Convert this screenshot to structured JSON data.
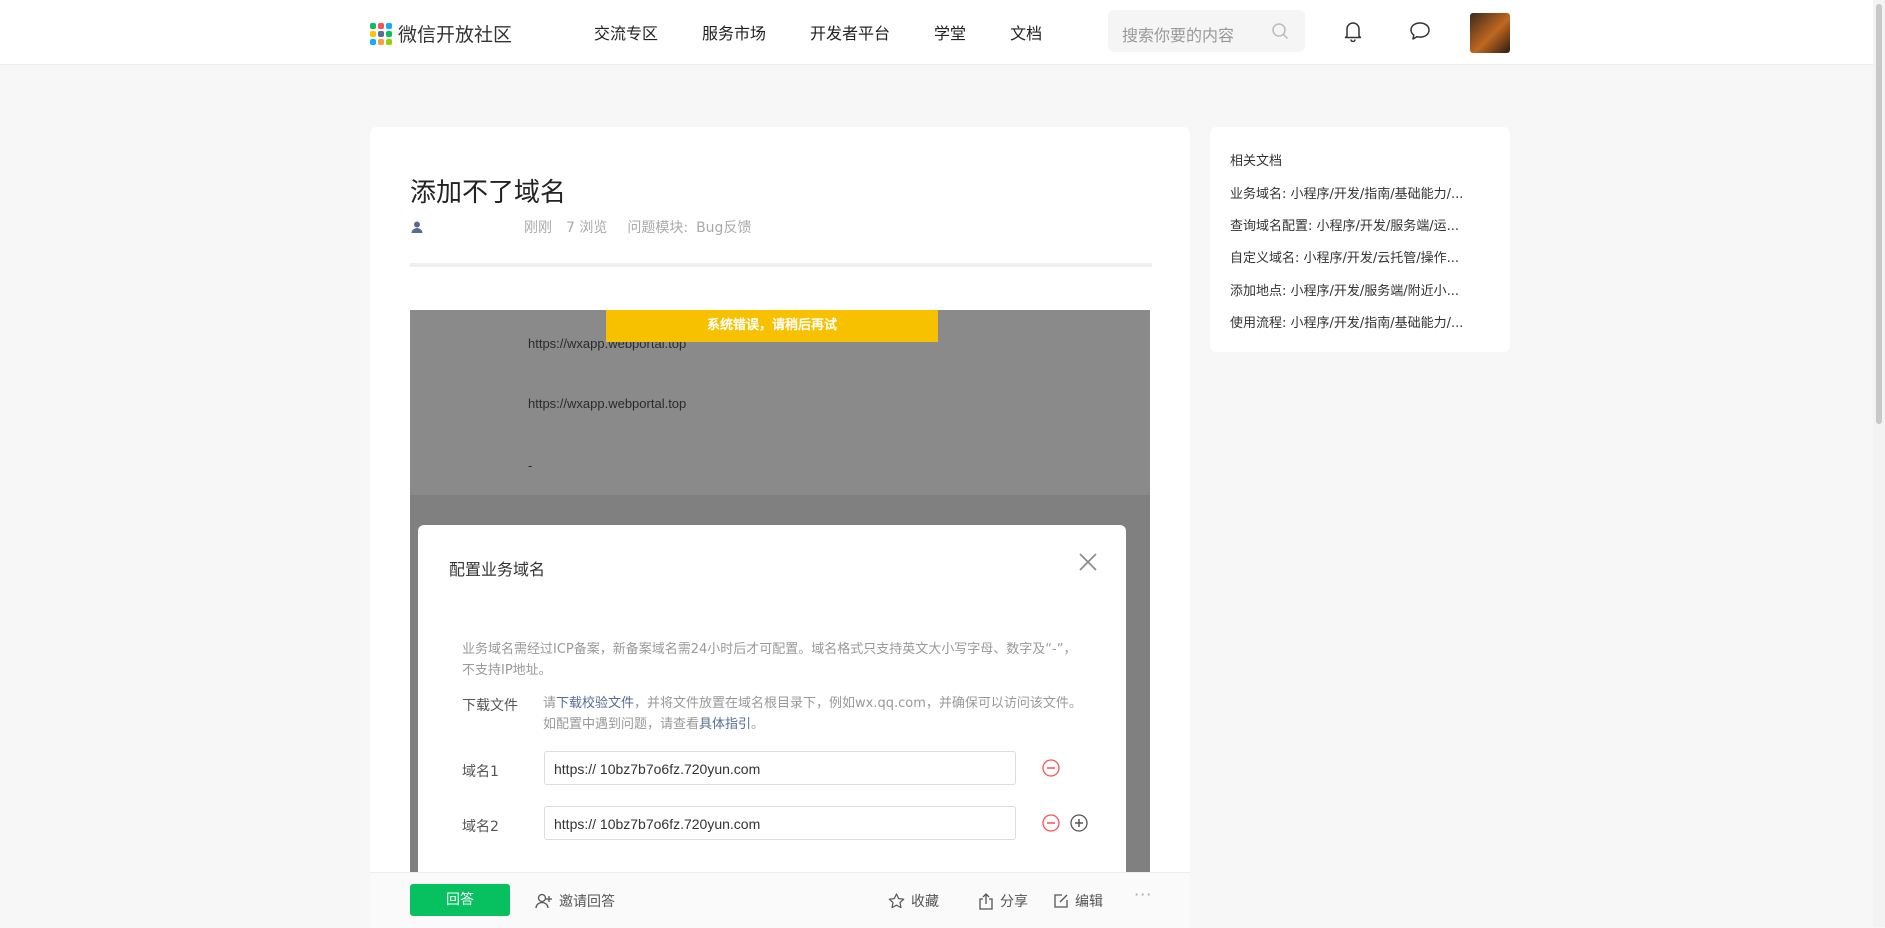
{
  "header": {
    "logo_text": "微信开放社区",
    "nav": [
      "交流专区",
      "服务市场",
      "开发者平台",
      "学堂",
      "文档"
    ],
    "search_placeholder": "搜索你要的内容"
  },
  "post": {
    "title": "添加不了域名",
    "time": "刚刚",
    "views": "7 浏览",
    "module_label": "问题模块:",
    "module_value": "Bug反馈"
  },
  "screenshot": {
    "error_toast": "系统错误，请稍后再试",
    "urls": [
      "https://wxapp.webportal.top",
      "https://wxapp.webportal.top",
      "-"
    ],
    "modal": {
      "title": "配置业务域名",
      "description": "业务域名需经过ICP备案，新备案域名需24小时后才可配置。域名格式只支持英文大小写字母、数字及“-”，不支持IP地址。",
      "download_label": "下载文件",
      "download_text_1": "请",
      "download_link": "下载校验文件",
      "download_text_2": "，并将文件放置在域名根目录下，例如wx.qq.com，并确保可以访问该文件。如配置中遇到问题，请查看",
      "guide_link": "具体指引",
      "download_text_3": "。",
      "domains": [
        {
          "label": "域名1",
          "value": "https:// 10bz7b7o6fz.720yun.com"
        },
        {
          "label": "域名2",
          "value": "https:// 10bz7b7o6fz.720yun.com"
        }
      ]
    }
  },
  "actions": {
    "answer": "回答",
    "invite": "邀请回答",
    "favorite": "收藏",
    "share": "分享",
    "edit": "编辑",
    "more": "···"
  },
  "sidebar": {
    "title": "相关文档",
    "items": [
      "业务域名: 小程序/开发/指南/基础能力/...",
      "查询域名配置: 小程序/开发/服务端/运...",
      "自定义域名: 小程序/开发/云托管/操作...",
      "添加地点: 小程序/开发/服务端/附近小...",
      "使用流程: 小程序/开发/指南/基础能力/..."
    ]
  },
  "colors": {
    "brand_green": "#07c160",
    "warning_yellow": "#f7c100",
    "link_blue": "#576b95",
    "danger_red": "#fa5151"
  }
}
